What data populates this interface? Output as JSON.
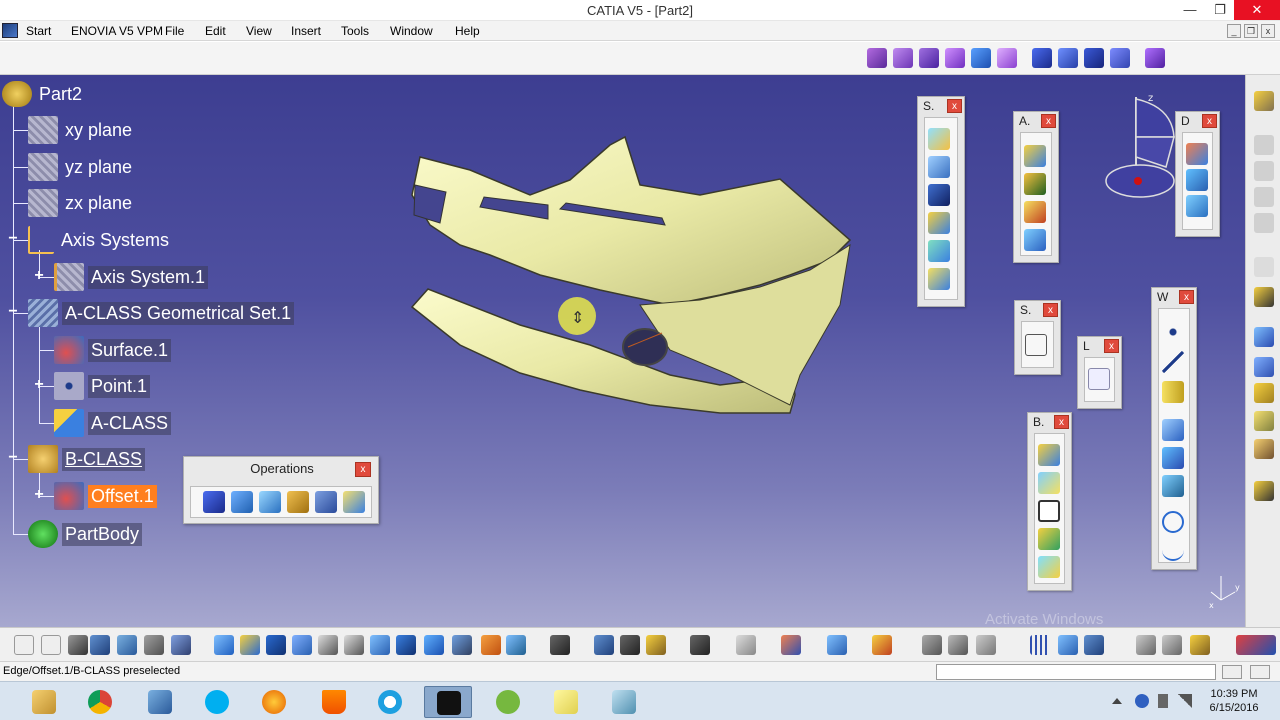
{
  "window": {
    "title": "CATIA V5 - [Part2]",
    "min": "—",
    "restore": "❐",
    "close": "✕"
  },
  "menu": {
    "items": [
      "Start",
      "ENOVIA V5 VPM",
      "File",
      "Edit",
      "View",
      "Insert",
      "Tools",
      "Window",
      "Help"
    ]
  },
  "mdi": {
    "min": "_",
    "restore": "❐",
    "close": "x"
  },
  "tree": {
    "root": "Part2",
    "nodes": {
      "xy": "xy plane",
      "yz": "yz plane",
      "zx": "zx plane",
      "axis_systems": "Axis Systems",
      "axis_system1": "Axis System.1",
      "geoset": "A-CLASS Geometrical Set.1",
      "surface1": "Surface.1",
      "point1": "Point.1",
      "aclass": "A-CLASS",
      "bclass": "B-CLASS",
      "offset1": "Offset.1",
      "partbody": "PartBody"
    }
  },
  "panels": {
    "operations": {
      "title": "Operations",
      "close": "x"
    },
    "s1": {
      "title": "S.",
      "close": "x"
    },
    "a1": {
      "title": "A.",
      "close": "x"
    },
    "d1": {
      "title": "D",
      "close": "x"
    },
    "s2": {
      "title": "S.",
      "close": "x"
    },
    "l1": {
      "title": "L",
      "close": "x"
    },
    "b1": {
      "title": "B.",
      "close": "x"
    },
    "w1": {
      "title": "W",
      "close": "x"
    }
  },
  "compass": {
    "z_label": "z"
  },
  "axes_indicator": {
    "y_label": "y",
    "x_label": "x"
  },
  "watermark": "Activate Windows",
  "status": {
    "text": "Edge/Offset.1/B-CLASS preselected"
  },
  "taskbar": {
    "clock_time": "10:39 PM",
    "clock_date": "6/15/2016"
  },
  "colors": {
    "viewport_top": "#3d3e91",
    "selection": "#ff7f1f",
    "part": "#f1f1b0",
    "close_red": "#e04a3c"
  }
}
